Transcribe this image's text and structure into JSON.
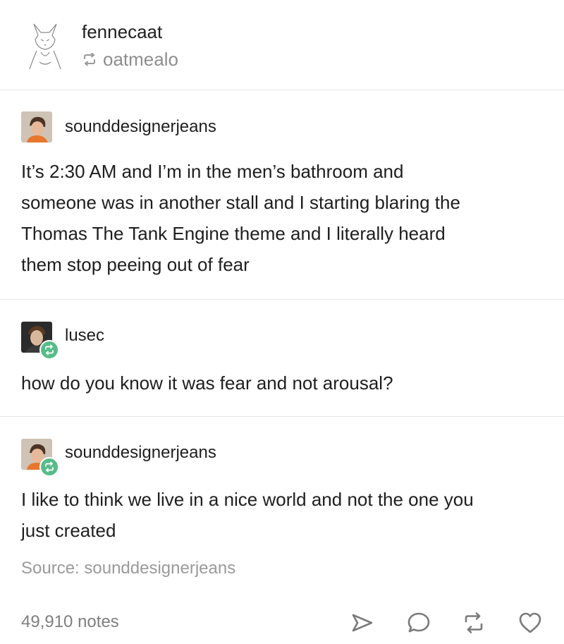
{
  "header": {
    "author": "fennecaat",
    "reblogged_from": "oatmealo",
    "reblog_icon": "reblog-icon"
  },
  "thread": [
    {
      "username": "sounddesignerjeans",
      "is_reblog": false,
      "lines": [
        "It’s 2:30 AM and I’m in the men’s bathroom and",
        "someone was in another stall and I starting blaring the",
        "Thomas The Tank Engine theme and I literally heard",
        "them stop peeing out of fear"
      ]
    },
    {
      "username": "lusec",
      "is_reblog": true,
      "lines": [
        "how do you know it was fear and not arousal?"
      ]
    },
    {
      "username": "sounddesignerjeans",
      "is_reblog": true,
      "lines": [
        "I like to think we live in a nice world and not the one you",
        "just created"
      ]
    }
  ],
  "source": "Source: sounddesignerjeans",
  "footer": {
    "notes": "49,910 notes",
    "actions": [
      "share-icon",
      "comment-icon",
      "reblog-icon",
      "heart-icon"
    ]
  },
  "colors": {
    "reblog_badge": "#56bc8a",
    "muted_text": "#9a9a9a",
    "divider": "#e6e6e6"
  }
}
